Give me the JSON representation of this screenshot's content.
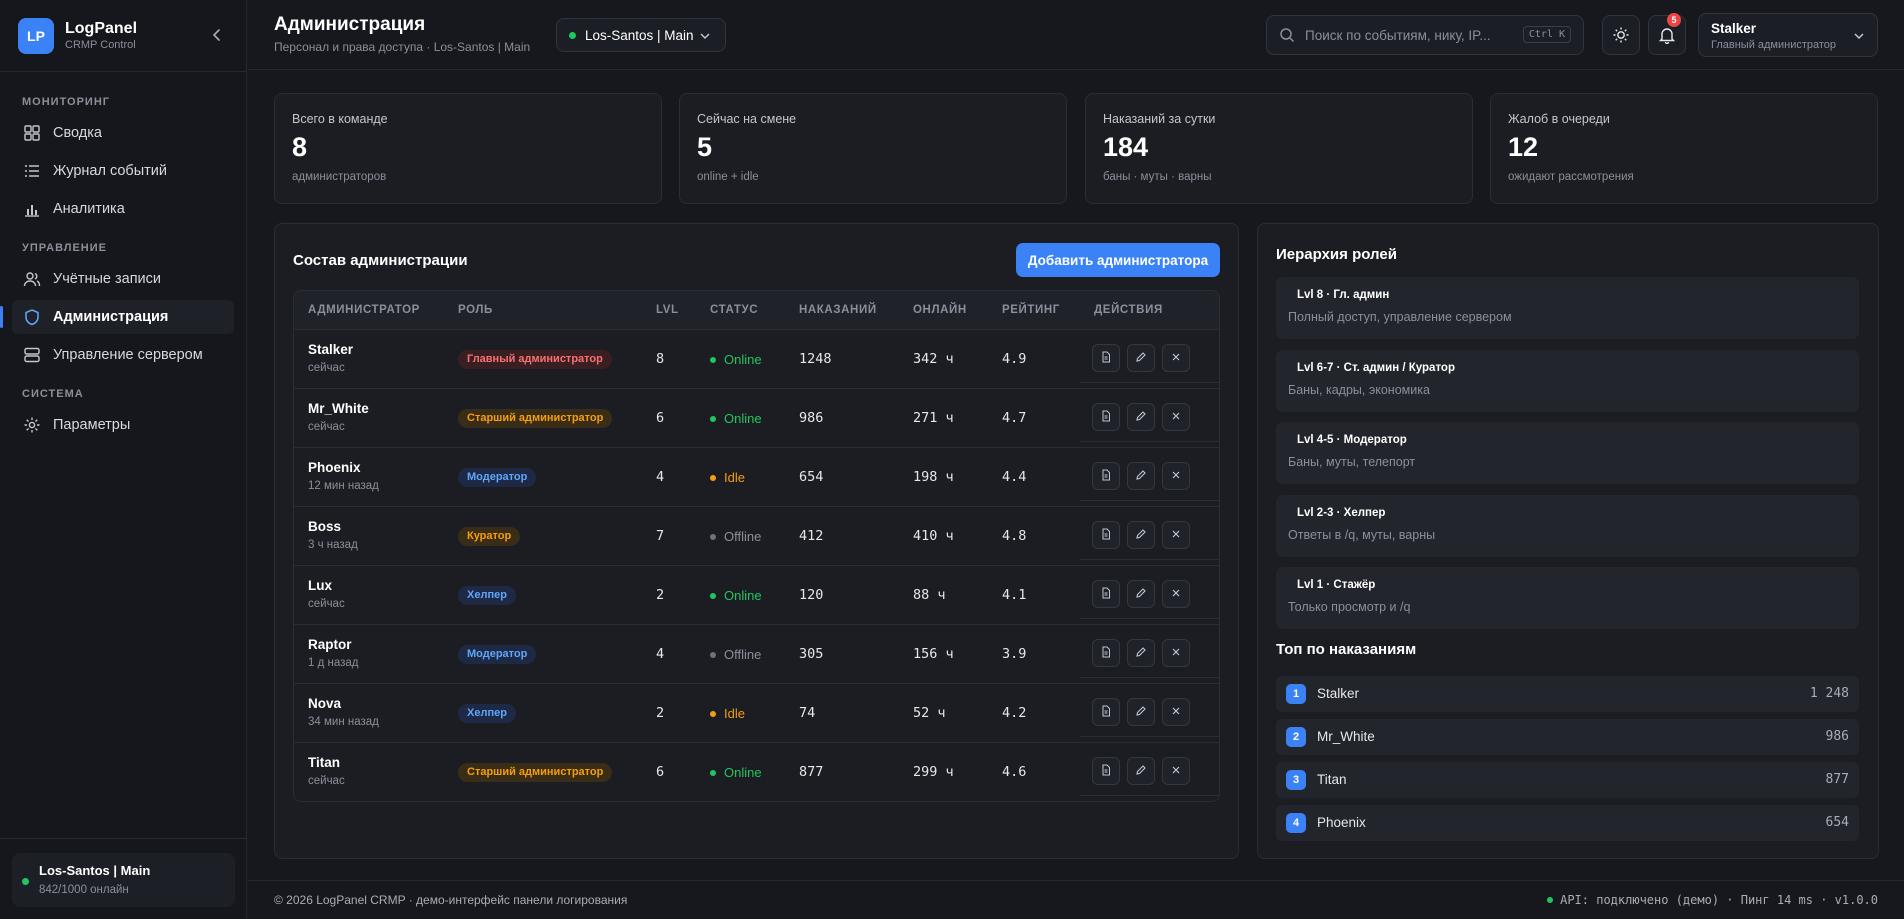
{
  "brand": {
    "logo": "LP",
    "title": "LogPanel",
    "subtitle": "CRMP Control"
  },
  "sidebar": {
    "sections": [
      {
        "title": "МОНИТОРИНГ",
        "items": [
          {
            "label": "Сводка",
            "icon": "dashboard-grid-icon"
          },
          {
            "label": "Журнал событий",
            "icon": "list-icon"
          },
          {
            "label": "Аналитика",
            "icon": "bar-chart-icon"
          }
        ]
      },
      {
        "title": "УПРАВЛЕНИЕ",
        "items": [
          {
            "label": "Учётные записи",
            "icon": "users-icon"
          },
          {
            "label": "Администрация",
            "icon": "shield-icon",
            "active": true
          },
          {
            "label": "Управление сервером",
            "icon": "server-icon"
          }
        ]
      },
      {
        "title": "СИСТЕМА",
        "items": [
          {
            "label": "Параметры",
            "icon": "gear-icon"
          }
        ]
      }
    ],
    "server": {
      "name": "Los-Santos | Main",
      "online": "842/1000 онлайн"
    }
  },
  "header": {
    "title": "Администрация",
    "subtitle": "Персонал и права доступа · Los-Santos | Main",
    "server_select": "Los-Santos | Main",
    "search_placeholder": "Поиск по событиям, нику, IP...",
    "search_shortcut": "Ctrl K",
    "notifications": "5",
    "user": {
      "name": "Stalker",
      "role": "Главный администратор"
    }
  },
  "stats": [
    {
      "label": "Всего в команде",
      "value": "8",
      "sub": "администраторов"
    },
    {
      "label": "Сейчас на смене",
      "value": "5",
      "sub": "online + idle"
    },
    {
      "label": "Наказаний за сутки",
      "value": "184",
      "sub": "баны · муты · варны"
    },
    {
      "label": "Жалоб в очереди",
      "value": "12",
      "sub": "ожидают рассмотрения"
    }
  ],
  "admins_panel": {
    "title": "Состав администрации",
    "add_button": "Добавить администратора",
    "columns": [
      "АДМИНИСТРАТОР",
      "РОЛЬ",
      "LVL",
      "СТАТУС",
      "НАКАЗАНИЙ",
      "ОНЛАЙН",
      "РЕЙТИНГ",
      "ДЕЙСТВИЯ"
    ],
    "rows": [
      {
        "name": "Stalker",
        "seen": "сейчас",
        "role": "Главный администратор",
        "role_color": "red",
        "lvl": "8",
        "status": "Online",
        "punishments": "1248",
        "online": "342 ч",
        "rating": "4.9"
      },
      {
        "name": "Mr_White",
        "seen": "сейчас",
        "role": "Старший администратор",
        "role_color": "amber",
        "lvl": "6",
        "status": "Online",
        "punishments": "986",
        "online": "271 ч",
        "rating": "4.7"
      },
      {
        "name": "Phoenix",
        "seen": "12 мин назад",
        "role": "Модератор",
        "role_color": "blue",
        "lvl": "4",
        "status": "Idle",
        "punishments": "654",
        "online": "198 ч",
        "rating": "4.4"
      },
      {
        "name": "Boss",
        "seen": "3 ч назад",
        "role": "Куратор",
        "role_color": "amber",
        "lvl": "7",
        "status": "Offline",
        "punishments": "412",
        "online": "410 ч",
        "rating": "4.8"
      },
      {
        "name": "Lux",
        "seen": "сейчас",
        "role": "Хелпер",
        "role_color": "blue",
        "lvl": "2",
        "status": "Online",
        "punishments": "120",
        "online": "88 ч",
        "rating": "4.1"
      },
      {
        "name": "Raptor",
        "seen": "1 д назад",
        "role": "Модератор",
        "role_color": "blue",
        "lvl": "4",
        "status": "Offline",
        "punishments": "305",
        "online": "156 ч",
        "rating": "3.9"
      },
      {
        "name": "Nova",
        "seen": "34 мин назад",
        "role": "Хелпер",
        "role_color": "blue",
        "lvl": "2",
        "status": "Idle",
        "punishments": "74",
        "online": "52 ч",
        "rating": "4.2"
      },
      {
        "name": "Titan",
        "seen": "сейчас",
        "role": "Старший администратор",
        "role_color": "amber",
        "lvl": "6",
        "status": "Online",
        "punishments": "877",
        "online": "299 ч",
        "rating": "4.6"
      }
    ]
  },
  "roles_panel": {
    "title": "Иерархия ролей",
    "roles": [
      {
        "title": "Lvl 8 · Гл. админ",
        "desc": "Полный доступ, управление сервером"
      },
      {
        "title": "Lvl 6-7 · Ст. админ / Куратор",
        "desc": "Баны, кадры, экономика"
      },
      {
        "title": "Lvl 4-5 · Модератор",
        "desc": "Баны, муты, телепорт"
      },
      {
        "title": "Lvl 2-3 · Хелпер",
        "desc": "Ответы в /q, муты, варны"
      },
      {
        "title": "Lvl 1 · Стажёр",
        "desc": "Только просмотр и /q"
      }
    ],
    "top_title": "Топ по наказаниям",
    "top": [
      {
        "rank": "1",
        "name": "Stalker",
        "value": "1 248"
      },
      {
        "rank": "2",
        "name": "Mr_White",
        "value": "986"
      },
      {
        "rank": "3",
        "name": "Titan",
        "value": "877"
      },
      {
        "rank": "4",
        "name": "Phoenix",
        "value": "654"
      }
    ]
  },
  "footer": {
    "left": "© 2026 LogPanel CRMP · демо-интерфейс панели логирования",
    "right": "API: подключено (демо) · Пинг 14 ms · v1.0.0"
  },
  "colors": {
    "accent": "#3b82f6",
    "online": "#22c55e",
    "idle": "#f59e0b",
    "danger": "#ef4444"
  }
}
